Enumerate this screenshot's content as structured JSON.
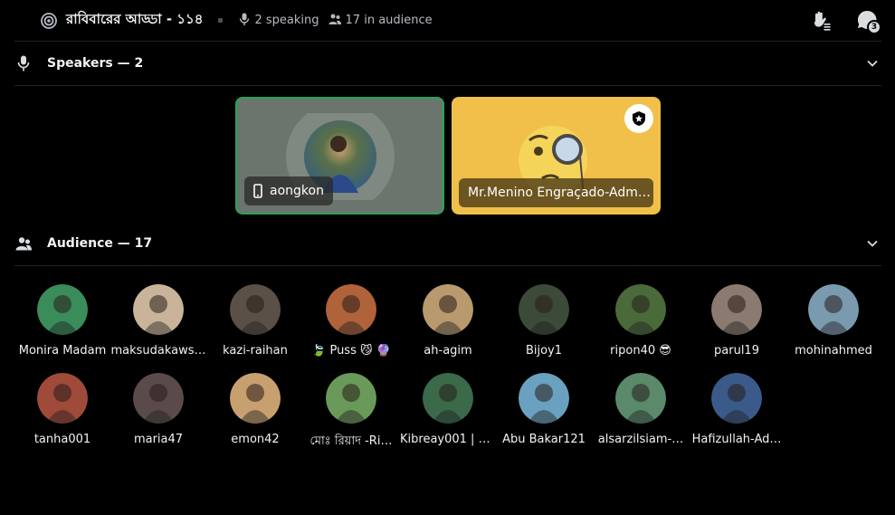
{
  "header": {
    "title": "রাবিবারের আড্ডা - ১১৪",
    "speaking": "2 speaking",
    "audience_count": "17 in audience",
    "chat_badge": "3"
  },
  "speakers_section": {
    "label": "Speakers — 2",
    "speakers": [
      {
        "name": "aongkon",
        "tile_color": "#6b756d",
        "speaking": true
      },
      {
        "name": "Mr.Menino Engraçado-Adm…",
        "tile_color": "#f0c04a",
        "moderator": true
      }
    ]
  },
  "audience_section": {
    "label": "Audience — 17",
    "members": [
      {
        "name": "Monira Madam",
        "color": "#3a8c5a"
      },
      {
        "name": "maksudakaws…",
        "color": "#c9b49a"
      },
      {
        "name": "kazi-raihan",
        "color": "#5a5048"
      },
      {
        "name": "🍃 Puss 😼 🔮",
        "color": "#b0623a"
      },
      {
        "name": "ah-agim",
        "color": "#b89a6e"
      },
      {
        "name": "Bijoy1",
        "color": "#3c4a3a"
      },
      {
        "name": "ripon40 😎",
        "color": "#4a6a3a"
      },
      {
        "name": "parul19",
        "color": "#8a7a70"
      },
      {
        "name": "mohinahmed",
        "color": "#7a9ab0"
      },
      {
        "name": "tanha001",
        "color": "#a04a3a"
      },
      {
        "name": "maria47",
        "color": "#5a4a4a"
      },
      {
        "name": "emon42",
        "color": "#c8a070"
      },
      {
        "name": "মোঃ রিয়াদ -Ri…",
        "color": "#6a9a5a"
      },
      {
        "name": "Kibreay001 | $…",
        "color": "#3a6a4a"
      },
      {
        "name": "Abu Bakar121",
        "color": "#6aa0c0"
      },
      {
        "name": "alsarzilsiam-…",
        "color": "#5a8a6a"
      },
      {
        "name": "Hafizullah-Ad…",
        "color": "#3a5a8a"
      }
    ]
  }
}
